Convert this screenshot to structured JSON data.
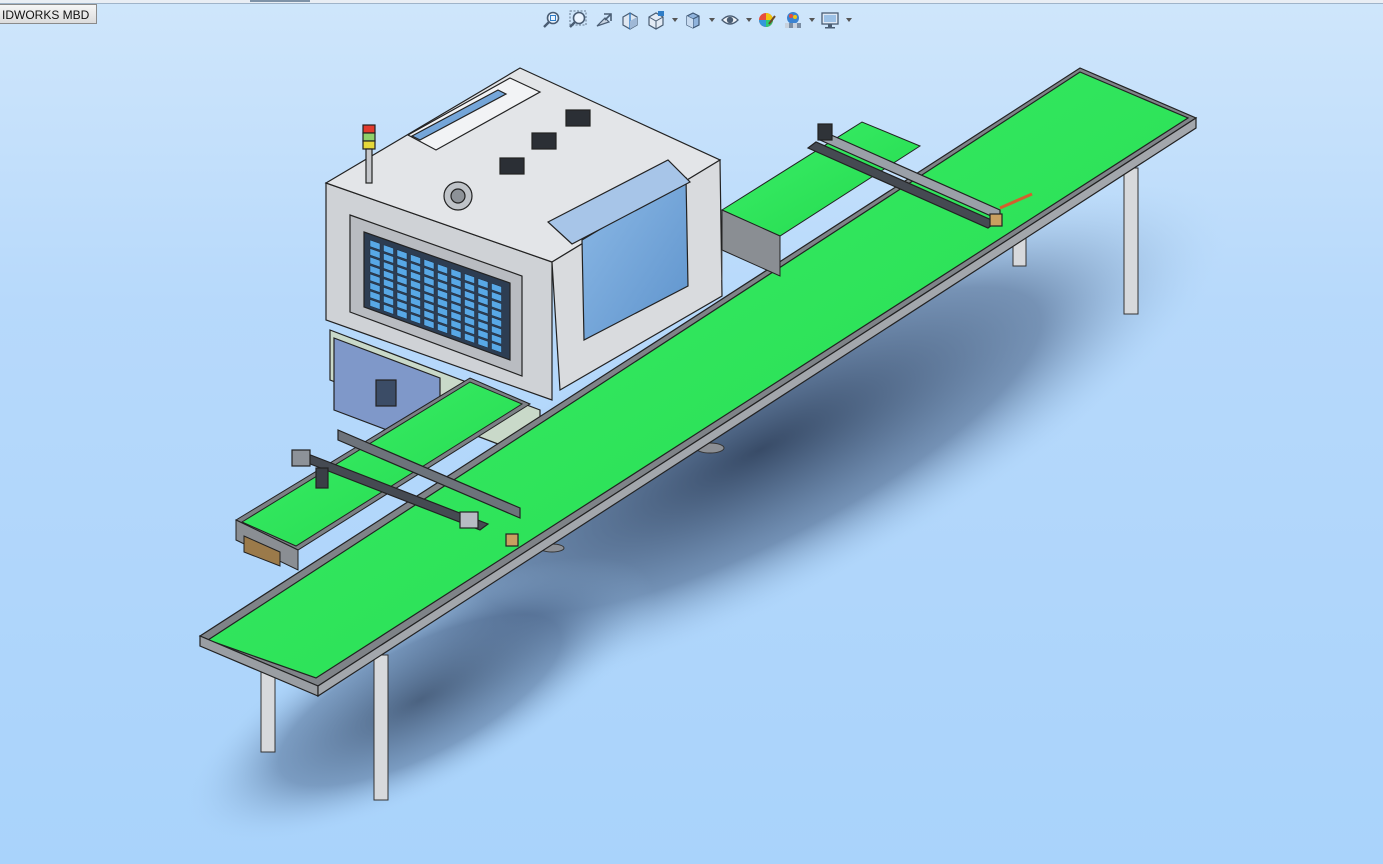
{
  "tab": {
    "label": "IDWORKS MBD"
  },
  "heads_up_toolbar": {
    "items": [
      {
        "icon": "zoom-to-fit-icon"
      },
      {
        "icon": "zoom-to-area-icon"
      },
      {
        "icon": "previous-view-icon"
      },
      {
        "icon": "section-view-icon"
      },
      {
        "icon": "view-orientation-icon",
        "dropdown": true
      },
      {
        "icon": "display-style-icon",
        "dropdown": true
      },
      {
        "icon": "hide-show-items-icon",
        "dropdown": true
      },
      {
        "icon": "edit-appearance-icon"
      },
      {
        "icon": "apply-scene-icon",
        "dropdown": true
      },
      {
        "icon": "view-settings-icon",
        "dropdown": true
      }
    ]
  },
  "model": {
    "description_icon": "conveyor-inspection-machine-assembly",
    "colors": {
      "belt": "#2ee65a",
      "frame": "#c9ccd1",
      "window": "#6fa3d8",
      "panel": "#6f8fc8",
      "background": "#b1d7fb"
    }
  }
}
